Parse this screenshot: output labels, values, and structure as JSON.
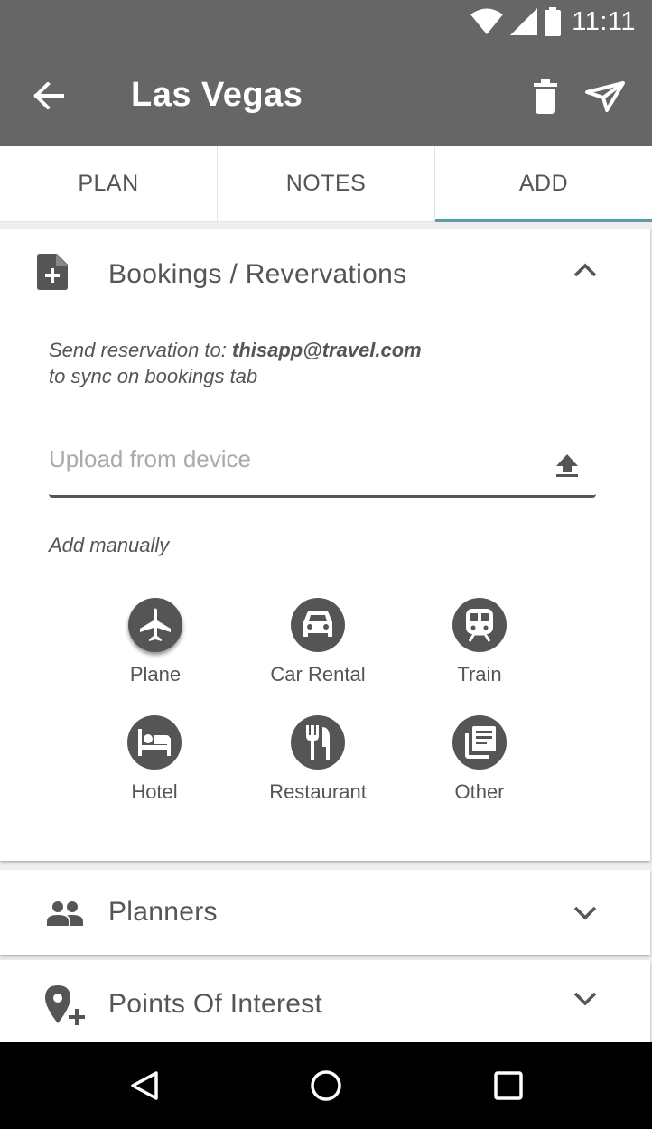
{
  "status_bar": {
    "time": "11:11",
    "icons": [
      "wifi-icon",
      "signal-icon",
      "battery-icon"
    ]
  },
  "app_bar": {
    "title": "Las Vegas",
    "icons": [
      "back-arrow-icon",
      "delete-icon",
      "send-icon"
    ]
  },
  "tabs": [
    {
      "label": "PLAN",
      "active": false
    },
    {
      "label": "NOTES",
      "active": false
    },
    {
      "label": "ADD",
      "active": true
    }
  ],
  "bookings": {
    "title": "Bookings / Revervations",
    "info_prefix": "Send reservation to: ",
    "email": "thisapp@travel.com",
    "info_suffix": "to sync on bookings tab",
    "upload_placeholder": "Upload from device",
    "add_manually": "Add manually",
    "options": [
      {
        "label": "Plane",
        "icon": "plane-icon"
      },
      {
        "label": "Car Rental",
        "icon": "car-icon"
      },
      {
        "label": "Train",
        "icon": "train-icon"
      },
      {
        "label": "Hotel",
        "icon": "hotel-icon"
      },
      {
        "label": "Restaurant",
        "icon": "restaurant-icon"
      },
      {
        "label": "Other",
        "icon": "other-icon"
      }
    ]
  },
  "planners": {
    "title": "Planners"
  },
  "points_of_interest": {
    "title": "Points Of Interest"
  },
  "nav_bar": {
    "icons": [
      "back-icon",
      "home-icon",
      "recents-icon"
    ]
  },
  "colors": {
    "app_bar": "#666666",
    "accent": "#5b9aa8",
    "icon_circle": "#555555",
    "nav_bar": "#000000"
  }
}
